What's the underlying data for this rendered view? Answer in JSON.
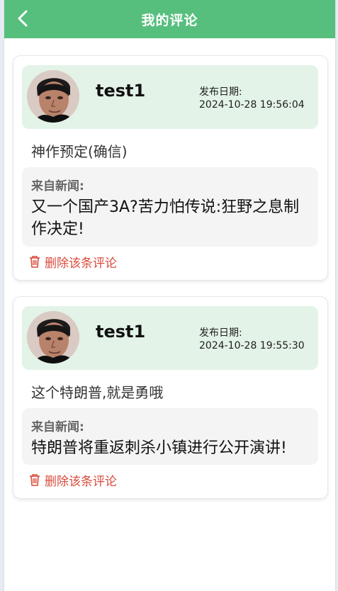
{
  "header": {
    "title": "我的评论",
    "back_icon": "chevron-left-icon"
  },
  "colors": {
    "header_bg": "#57bf7d",
    "user_panel_bg": "#e3f3e7",
    "news_panel_bg": "#f4f4f4",
    "delete_color": "#d94a3b"
  },
  "comments": [
    {
      "username": "test1",
      "date_label": "发布日期:",
      "date": "2024-10-28 19:56:04",
      "text": "神作预定(确信)",
      "news_label": "来自新闻:",
      "news_title": "又一个国产3A?苦力怕传说:狂野之息制作决定!",
      "delete_label": "删除该条评论",
      "delete_icon": "trash-icon"
    },
    {
      "username": "test1",
      "date_label": "发布日期:",
      "date": "2024-10-28 19:55:30",
      "text": "这个特朗普,就是勇哦",
      "news_label": "来自新闻:",
      "news_title": "特朗普将重返刺杀小镇进行公开演讲!",
      "delete_label": "删除该条评论",
      "delete_icon": "trash-icon"
    }
  ]
}
